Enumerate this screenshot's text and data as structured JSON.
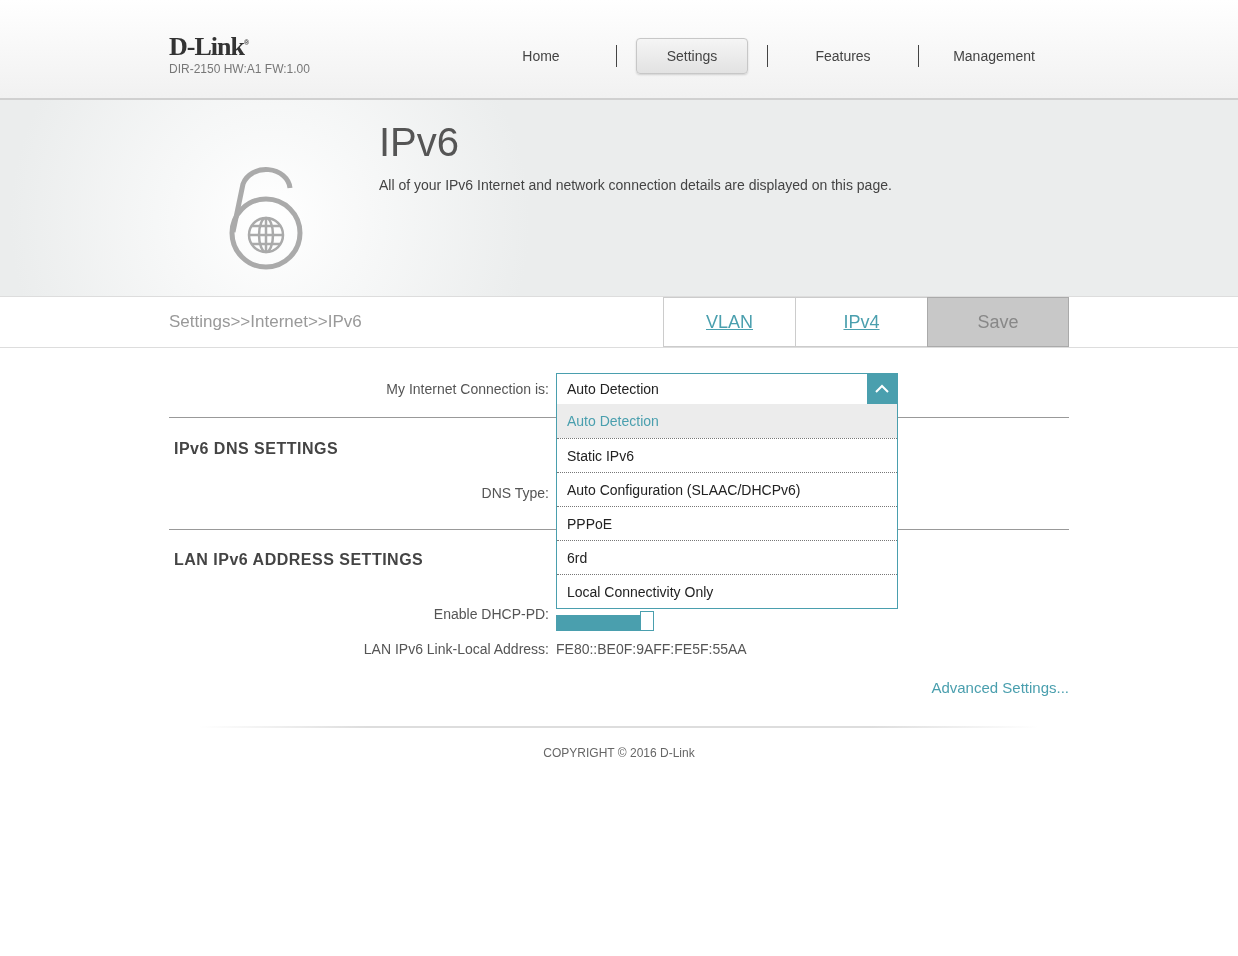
{
  "header": {
    "logo": "D-Link",
    "logo_mark": "®",
    "model": "DIR-2150 HW:A1 FW:1.00",
    "nav": [
      {
        "label": "Home",
        "selected": false
      },
      {
        "label": "Settings",
        "selected": true
      },
      {
        "label": "Features",
        "selected": false
      },
      {
        "label": "Management",
        "selected": false
      }
    ]
  },
  "banner": {
    "title": "IPv6",
    "description": "All of your IPv6 Internet and network connection details are displayed on this page."
  },
  "toolbar": {
    "breadcrumb": "Settings>>Internet>>IPv6",
    "tabs": [
      {
        "label": "VLAN",
        "kind": "link"
      },
      {
        "label": "IPv4",
        "kind": "link"
      },
      {
        "label": "Save",
        "kind": "save"
      }
    ]
  },
  "connection": {
    "label": "My Internet Connection is:",
    "value": "Auto Detection",
    "expanded": true,
    "options": [
      {
        "label": "Auto Detection",
        "selected": true
      },
      {
        "label": "Static IPv6",
        "selected": false
      },
      {
        "label": "Auto Configuration (SLAAC/DHCPv6)",
        "selected": false
      },
      {
        "label": "PPPoE",
        "selected": false
      },
      {
        "label": "6rd",
        "selected": false
      },
      {
        "label": "Local Connectivity Only",
        "selected": false
      }
    ]
  },
  "dns_section": {
    "title": "IPv6 DNS SETTINGS",
    "dns_type_label": "DNS Type:"
  },
  "lan_section": {
    "title": "LAN IPv6 ADDRESS SETTINGS",
    "dhcp_pd_label": "Enable DHCP-PD:",
    "dhcp_pd_on": true,
    "link_local_label": "LAN IPv6 Link-Local Address:",
    "link_local_value": "FE80::BE0F:9AFF:FE5F:55AA"
  },
  "advanced_link": "Advanced Settings...",
  "footer": "COPYRIGHT © 2016 D-Link"
}
